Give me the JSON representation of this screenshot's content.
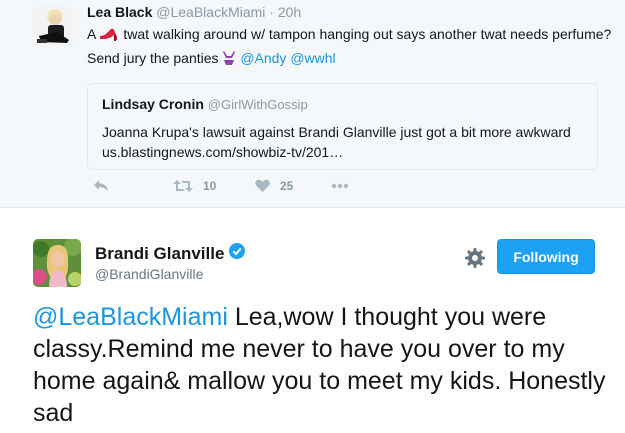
{
  "reply_tweet": {
    "name": "Lea Black",
    "handle": "@LeaBlackMiami",
    "separator": "·",
    "time": "20h",
    "text_prefix": "A",
    "text_main": "twat walking around w/ tampon hanging out says another twat needs perfume? Send jury the panties",
    "mention_1": "@Andy",
    "mention_2": "@wwhl",
    "icons": [
      "high-heel-emoji",
      "bikini-emoji"
    ],
    "quoted": {
      "name": "Lindsay Cronin",
      "handle": "@GirlWithGossip",
      "text": "Joanna Krupa's lawsuit against Brandi Glanville just got a bit more awkward us.blastingnews.com/showbiz-tv/201…"
    },
    "actions": {
      "retweet_count": "10",
      "like_count": "25"
    }
  },
  "main_tweet": {
    "name": "Brandi Glanville",
    "handle": "@BrandiGlanville",
    "follow_label": "Following",
    "mention": "@LeaBlackMiami",
    "text": " Lea,wow I thought you were classy.Remind me never to have you over to my home again& mallow you to meet my kids. Honestly sad",
    "colors": {
      "link": "#1b95e0",
      "button": "#1da1f2",
      "verified": "#1da1f2"
    }
  }
}
